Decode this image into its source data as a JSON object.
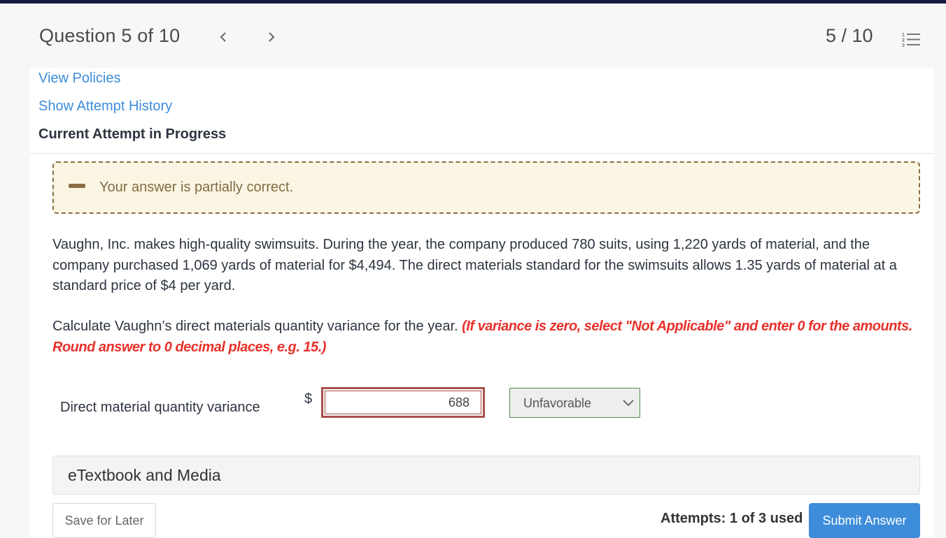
{
  "header": {
    "question_title": "Question 5 of 10",
    "question_count": "5 / 10",
    "prev_icon": "chevron-left-icon",
    "next_icon": "chevron-right-icon",
    "list_icon": "numbered-list-icon"
  },
  "links": {
    "view_policies": "View Policies",
    "show_attempt_history": "Show Attempt History"
  },
  "attempt_heading": "Current Attempt in Progress",
  "feedback": {
    "icon": "partial-dash-icon",
    "message": "Your answer is partially correct."
  },
  "problem_text": "Vaughn, Inc. makes high-quality swimsuits. During the year, the company produced 780 suits, using 1,220 yards of material, and the company purchased 1,069 yards of material for $4,494. The direct materials standard for the swimsuits allows 1.35 yards of material at a standard price of $4 per yard.",
  "instruction": {
    "text": "Calculate Vaughn’s direct materials quantity variance for the year. ",
    "hint": "(If variance is zero, select \"Not Applicable\" and enter 0 for the amounts. Round answer to 0 decimal places, e.g. 15.)"
  },
  "answer_row": {
    "label": "Direct material quantity variance",
    "currency": "$",
    "amount": "688",
    "selected_option": "Unfavorable"
  },
  "etextbook_label": "eTextbook and Media",
  "footer": {
    "save_label": "Save for Later",
    "attempts_text": "Attempts: 1 of 3 used",
    "submit_label": "Submit Answer"
  },
  "colors": {
    "accent_blue": "#3d8ddb",
    "top_bar": "#161c42",
    "hint_red": "#e8312b",
    "feedback_border": "#8a7044",
    "feedback_bg": "#fbf6e3",
    "input_error_border": "#a5504a",
    "select_border": "#4b8a4b"
  }
}
